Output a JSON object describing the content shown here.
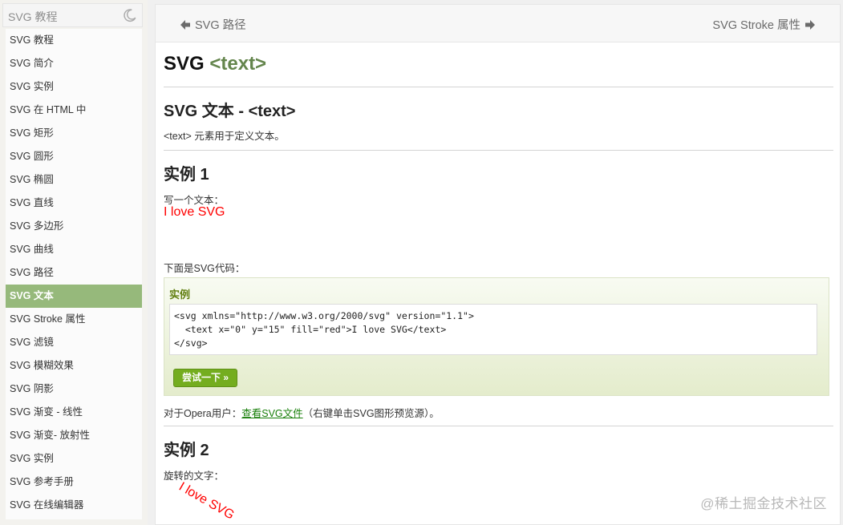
{
  "sidebar": {
    "search_placeholder": "SVG 教程",
    "theme_icon": "moon-icon",
    "items": [
      {
        "label": "SVG 教程"
      },
      {
        "label": "SVG 简介"
      },
      {
        "label": "SVG 实例"
      },
      {
        "label": "SVG 在 HTML 中"
      },
      {
        "label": "SVG 矩形"
      },
      {
        "label": "SVG 圆形"
      },
      {
        "label": "SVG 椭圆"
      },
      {
        "label": "SVG 直线"
      },
      {
        "label": "SVG 多边形"
      },
      {
        "label": "SVG 曲线"
      },
      {
        "label": "SVG 路径"
      },
      {
        "label": "SVG 文本",
        "active": true
      },
      {
        "label": "SVG Stroke 属性"
      },
      {
        "label": "SVG 滤镜"
      },
      {
        "label": "SVG 模糊效果"
      },
      {
        "label": "SVG 阴影"
      },
      {
        "label": "SVG 渐变 - 线性"
      },
      {
        "label": "SVG 渐变- 放射性"
      },
      {
        "label": "SVG 实例"
      },
      {
        "label": "SVG 参考手册"
      },
      {
        "label": "SVG 在线编辑器"
      }
    ],
    "active_color": "#96b97b"
  },
  "nav": {
    "prev_label": "SVG 路径",
    "next_label": "SVG Stroke 属性"
  },
  "main": {
    "title_prefix": "SVG",
    "title_tag": "<text>",
    "section_heading": "SVG 文本 - <text>",
    "intro": "<text> 元素用于定义文本。",
    "example1": {
      "heading": "实例 1",
      "desc": "写一个文本：",
      "demo_text": "I love SVG",
      "code_intro": "下面是SVG代码：",
      "box_title": "实例",
      "code_lines": [
        "<svg xmlns=\"http://www.w3.org/2000/svg\" version=\"1.1\">",
        "  <text x=\"0\" y=\"15\" fill=\"red\">I love SVG</text>",
        "</svg>"
      ],
      "try_button": "尝试一下 »",
      "opera_prefix": "对于Opera用户：",
      "opera_link": "查看SVG文件",
      "opera_suffix": "（右键单击SVG图形预览源）。"
    },
    "example2": {
      "heading": "实例 2",
      "desc": "旋转的文字：",
      "demo_text": "I love SVG"
    }
  },
  "watermark": "@稀土掘金技术社区"
}
